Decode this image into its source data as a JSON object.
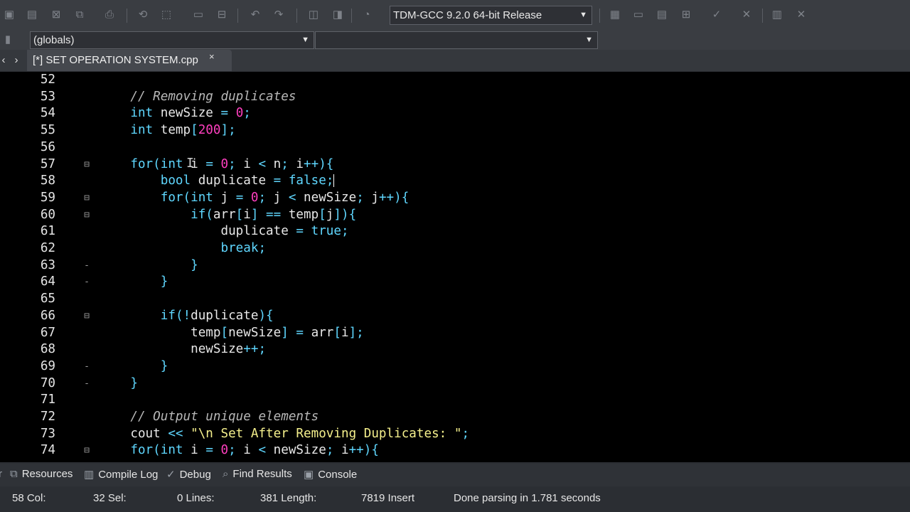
{
  "toolbar": {
    "compiler_select": "TDM-GCC 9.2.0 64-bit Release",
    "icons": [
      "new-file-icon",
      "save-all-icon",
      "close-file-icon",
      "close-all-icon",
      "print-icon",
      "find-icon",
      "replace-icon",
      "run-icon",
      "indent-icon",
      "unindent-icon",
      "undo-icon",
      "redo-icon",
      "new-class-icon",
      "new-member-icon",
      "comment-icon",
      "compile-icon",
      "run-project-icon",
      "compile-run-icon",
      "rebuild-icon",
      "check-icon",
      "stop-icon",
      "chart-icon",
      "close-icon"
    ]
  },
  "scope_bar": {
    "globals_select": "(globals)",
    "member_select": ""
  },
  "tabs": [
    {
      "label": "[*] SET OPERATION SYSTEM.cpp",
      "close": "×"
    }
  ],
  "editor": {
    "lines": [
      {
        "n": "52",
        "tokens": []
      },
      {
        "n": "53",
        "tokens": [
          [
            "    ",
            "id"
          ],
          [
            "// Removing duplicates",
            "com"
          ]
        ]
      },
      {
        "n": "54",
        "tokens": [
          [
            "    ",
            "id"
          ],
          [
            "int",
            "kw"
          ],
          [
            " newSize ",
            "id"
          ],
          [
            "=",
            "op"
          ],
          [
            " ",
            "id"
          ],
          [
            "0",
            "num"
          ],
          [
            ";",
            "op"
          ]
        ]
      },
      {
        "n": "55",
        "tokens": [
          [
            "    ",
            "id"
          ],
          [
            "int",
            "kw"
          ],
          [
            " temp",
            "id"
          ],
          [
            "[",
            "op"
          ],
          [
            "200",
            "num"
          ],
          [
            "];",
            "op"
          ]
        ]
      },
      {
        "n": "56",
        "tokens": []
      },
      {
        "n": "57",
        "fold": "⊟",
        "tokens": [
          [
            "    ",
            "id"
          ],
          [
            "for",
            "kw"
          ],
          [
            "(",
            "op"
          ],
          [
            "int",
            "kw"
          ],
          [
            " i ",
            "id"
          ],
          [
            "=",
            "op"
          ],
          [
            " ",
            "id"
          ],
          [
            "0",
            "num"
          ],
          [
            ";",
            "op"
          ],
          [
            " i ",
            "id"
          ],
          [
            "<",
            "op"
          ],
          [
            " n",
            "id"
          ],
          [
            ";",
            "op"
          ],
          [
            " i",
            "id"
          ],
          [
            "++){",
            "op"
          ]
        ]
      },
      {
        "n": "58",
        "tokens": [
          [
            "        ",
            "id"
          ],
          [
            "bool",
            "kw"
          ],
          [
            " duplicate ",
            "id"
          ],
          [
            "=",
            "op"
          ],
          [
            " ",
            "id"
          ],
          [
            "false",
            "kw"
          ],
          [
            ";",
            "op"
          ]
        ],
        "caret": true
      },
      {
        "n": "59",
        "fold": "⊟",
        "tokens": [
          [
            "        ",
            "id"
          ],
          [
            "for",
            "kw"
          ],
          [
            "(",
            "op"
          ],
          [
            "int",
            "kw"
          ],
          [
            " j ",
            "id"
          ],
          [
            "=",
            "op"
          ],
          [
            " ",
            "id"
          ],
          [
            "0",
            "num"
          ],
          [
            ";",
            "op"
          ],
          [
            " j ",
            "id"
          ],
          [
            "<",
            "op"
          ],
          [
            " newSize",
            "id"
          ],
          [
            ";",
            "op"
          ],
          [
            " j",
            "id"
          ],
          [
            "++){",
            "op"
          ]
        ]
      },
      {
        "n": "60",
        "fold": "⊟",
        "tokens": [
          [
            "            ",
            "id"
          ],
          [
            "if",
            "kw"
          ],
          [
            "(",
            "op"
          ],
          [
            "arr",
            "id"
          ],
          [
            "[",
            "op"
          ],
          [
            "i",
            "id"
          ],
          [
            "]",
            "op"
          ],
          [
            " ",
            "id"
          ],
          [
            "==",
            "op"
          ],
          [
            " temp",
            "id"
          ],
          [
            "[",
            "op"
          ],
          [
            "j",
            "id"
          ],
          [
            "]){",
            "op"
          ]
        ]
      },
      {
        "n": "61",
        "tokens": [
          [
            "                ",
            "id"
          ],
          [
            "duplicate ",
            "id"
          ],
          [
            "=",
            "op"
          ],
          [
            " ",
            "id"
          ],
          [
            "true",
            "kw"
          ],
          [
            ";",
            "op"
          ]
        ]
      },
      {
        "n": "62",
        "tokens": [
          [
            "                ",
            "id"
          ],
          [
            "break",
            "kw"
          ],
          [
            ";",
            "op"
          ]
        ]
      },
      {
        "n": "63",
        "fold": "-",
        "tokens": [
          [
            "            ",
            "id"
          ],
          [
            "}",
            "op"
          ]
        ]
      },
      {
        "n": "64",
        "fold": "-",
        "tokens": [
          [
            "        ",
            "id"
          ],
          [
            "}",
            "op"
          ]
        ]
      },
      {
        "n": "65",
        "tokens": []
      },
      {
        "n": "66",
        "fold": "⊟",
        "tokens": [
          [
            "        ",
            "id"
          ],
          [
            "if",
            "kw"
          ],
          [
            "(!",
            "op"
          ],
          [
            "duplicate",
            "id"
          ],
          [
            "){",
            "op"
          ]
        ]
      },
      {
        "n": "67",
        "tokens": [
          [
            "            ",
            "id"
          ],
          [
            "temp",
            "id"
          ],
          [
            "[",
            "op"
          ],
          [
            "newSize",
            "id"
          ],
          [
            "]",
            "op"
          ],
          [
            " ",
            "id"
          ],
          [
            "=",
            "op"
          ],
          [
            " arr",
            "id"
          ],
          [
            "[",
            "op"
          ],
          [
            "i",
            "id"
          ],
          [
            "];",
            "op"
          ]
        ]
      },
      {
        "n": "68",
        "tokens": [
          [
            "            ",
            "id"
          ],
          [
            "newSize",
            "id"
          ],
          [
            "++;",
            "op"
          ]
        ]
      },
      {
        "n": "69",
        "fold": "-",
        "tokens": [
          [
            "        ",
            "id"
          ],
          [
            "}",
            "op"
          ]
        ]
      },
      {
        "n": "70",
        "fold": "-",
        "tokens": [
          [
            "    ",
            "id"
          ],
          [
            "}",
            "op"
          ]
        ]
      },
      {
        "n": "71",
        "tokens": []
      },
      {
        "n": "72",
        "tokens": [
          [
            "    ",
            "id"
          ],
          [
            "// Output unique elements",
            "com"
          ]
        ]
      },
      {
        "n": "73",
        "tokens": [
          [
            "    ",
            "id"
          ],
          [
            "cout ",
            "id"
          ],
          [
            "<<",
            "op"
          ],
          [
            " ",
            "id"
          ],
          [
            "\"\\n Set After Removing Duplicates: \"",
            "str"
          ],
          [
            ";",
            "op"
          ]
        ]
      },
      {
        "n": "74",
        "fold": "⊟",
        "tokens": [
          [
            "    ",
            "id"
          ],
          [
            "for",
            "kw"
          ],
          [
            "(",
            "op"
          ],
          [
            "int",
            "kw"
          ],
          [
            " i ",
            "id"
          ],
          [
            "=",
            "op"
          ],
          [
            " ",
            "id"
          ],
          [
            "0",
            "num"
          ],
          [
            ";",
            "op"
          ],
          [
            " i ",
            "id"
          ],
          [
            "<",
            "op"
          ],
          [
            " newSize",
            "id"
          ],
          [
            ";",
            "op"
          ],
          [
            " i",
            "id"
          ],
          [
            "++){",
            "op"
          ]
        ]
      }
    ]
  },
  "bottom_tabs": [
    {
      "icon": "resources-icon",
      "label": "Resources"
    },
    {
      "icon": "compile-log-icon",
      "label": "Compile Log"
    },
    {
      "icon": "debug-icon",
      "label": "Debug"
    },
    {
      "icon": "find-results-icon",
      "label": "Find Results"
    },
    {
      "icon": "console-icon",
      "label": "Console"
    }
  ],
  "status": {
    "line": "58 Col:",
    "col": "32 Sel:",
    "sel": "0 Lines:",
    "lines": "381 Length:",
    "length": "7819 Insert",
    "message": "Done parsing in 1.781 seconds"
  },
  "colors": {
    "keyword": "#5fd7ff",
    "number": "#ff3fbf",
    "string": "#f5f08c",
    "comment": "#b8b8b8",
    "editor_bg": "#000000"
  }
}
